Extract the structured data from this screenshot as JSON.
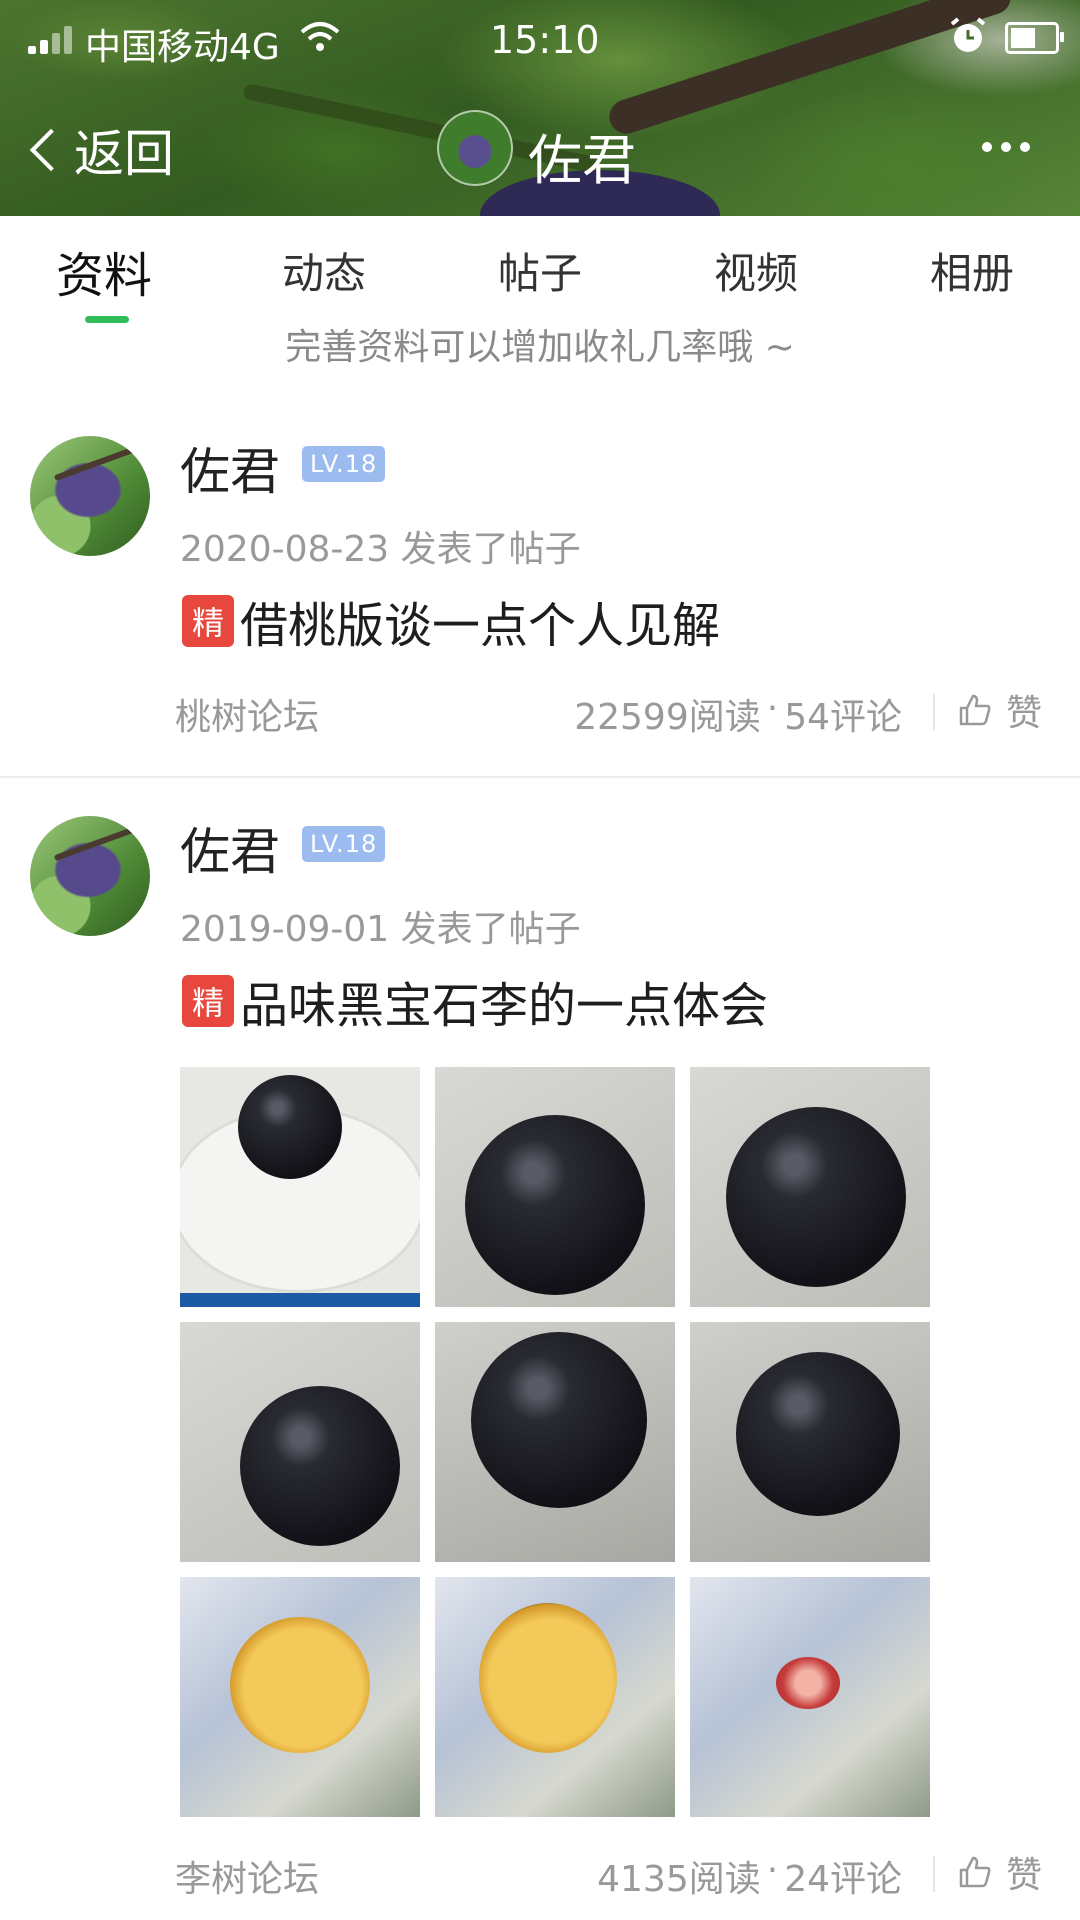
{
  "status_bar": {
    "carrier": "中国移动4G",
    "time": "15:10"
  },
  "nav": {
    "back_label": "返回",
    "title": "佐君"
  },
  "tabs": [
    {
      "label": "资料",
      "active": true
    },
    {
      "label": "动态",
      "active": false
    },
    {
      "label": "帖子",
      "active": false
    },
    {
      "label": "视频",
      "active": false
    },
    {
      "label": "相册",
      "active": false
    }
  ],
  "hint": "完善资料可以增加收礼几率哦 ~",
  "posts": [
    {
      "username": "佐君",
      "level": "LV.18",
      "date_action": "2020-08-23 发表了帖子",
      "badge": "精",
      "title": "借桃版谈一点个人见解",
      "forum": "桃树论坛",
      "reads": "22599阅读",
      "dot": "·",
      "comments": "54评论",
      "like_label": "赞"
    },
    {
      "username": "佐君",
      "level": "LV.18",
      "date_action": "2019-09-01 发表了帖子",
      "badge": "精",
      "title": "品味黑宝石李的一点体会",
      "forum": "李树论坛",
      "reads": "4135阅读",
      "dot": "·",
      "comments": "24评论",
      "like_label": "赞"
    }
  ],
  "colors": {
    "accent_green": "#2fbd5a",
    "level_badge": "#9cbcf0",
    "featured_badge": "#e8473e"
  }
}
